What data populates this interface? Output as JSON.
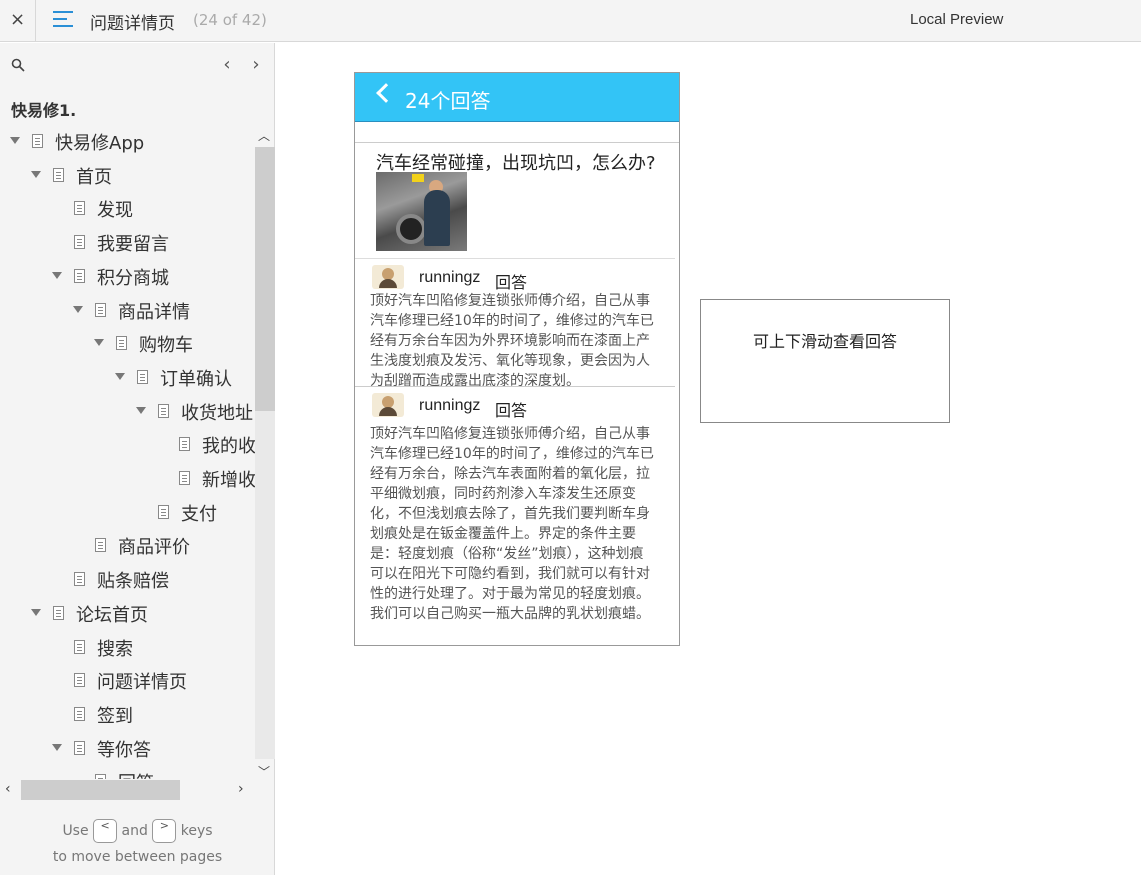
{
  "topbar": {
    "close_label": "×",
    "page_title": "问题详情页",
    "page_count": "(24 of 42)",
    "preview_label": "Local Preview"
  },
  "sidebar": {
    "project_title": "快易修1.",
    "tree": [
      {
        "label": "快易修App",
        "depth": 0,
        "expanded": true
      },
      {
        "label": "首页",
        "depth": 1,
        "expanded": true
      },
      {
        "label": "发现",
        "depth": 2
      },
      {
        "label": "我要留言",
        "depth": 2
      },
      {
        "label": "积分商城",
        "depth": 2,
        "expanded": true
      },
      {
        "label": "商品详情",
        "depth": 3,
        "expanded": true
      },
      {
        "label": "购物车",
        "depth": 4,
        "expanded": true
      },
      {
        "label": "订单确认",
        "depth": 5,
        "expanded": true
      },
      {
        "label": "收货地址",
        "depth": 6,
        "expanded": true
      },
      {
        "label": "我的收",
        "depth": 7
      },
      {
        "label": "新增收",
        "depth": 7
      },
      {
        "label": "支付",
        "depth": 6
      },
      {
        "label": "商品评价",
        "depth": 3
      },
      {
        "label": "贴条赔偿",
        "depth": 2
      },
      {
        "label": "论坛首页",
        "depth": 1,
        "expanded": true
      },
      {
        "label": "搜索",
        "depth": 2
      },
      {
        "label": "问题详情页",
        "depth": 2
      },
      {
        "label": "签到",
        "depth": 2
      },
      {
        "label": "等你答",
        "depth": 2,
        "expanded": true
      },
      {
        "label": "回答",
        "depth": 3
      }
    ],
    "vscroll_fraction": 0.43,
    "keys_hint": {
      "use": "Use",
      "key_prev": "<",
      "and": "and",
      "key_next": ">",
      "keys": "keys",
      "line2": "to move between pages"
    }
  },
  "phone": {
    "header_title": "24个回答",
    "question": "汽车经常碰撞，出现坑凹，怎么办?",
    "answers": [
      {
        "user": "runningz",
        "tag": "回答",
        "lines": [
          "顶好汽车凹陷修复连锁张师傅介绍，自己从事",
          "汽车修理已经10年的时间了，维修过的汽车已",
          "经有万余台车因为外界环境影响而在漆面上产",
          "生浅度划痕及发污、氧化等现象，更会因为人",
          "为刮蹭而造成露出底漆的深度划。"
        ]
      },
      {
        "user": "runningz",
        "tag": "回答",
        "lines": [
          "顶好汽车凹陷修复连锁张师傅介绍，自己从事",
          "汽车修理已经10年的时间了，维修过的汽车已",
          "经有万余台，除去汽车表面附着的氧化层，拉",
          "平细微划痕，同时药剂渗入车漆发生还原变",
          "化，不但浅划痕去除了，首先我们要判断车身",
          "划痕处是在钣金覆盖件上。界定的条件主要",
          "是：轻度划痕（俗称“发丝”划痕），这种划痕",
          "可以在阳光下可隐约看到，我们就可以有针对",
          "性的进行处理了。对于最为常见的轻度划痕。",
          "我们可以自己购买一瓶大品牌的乳状划痕蜡。"
        ]
      }
    ]
  },
  "note": {
    "text": "可上下滑动查看回答"
  },
  "colors": {
    "header_blue": "#33c4f6",
    "menu_icon_blue": "#2a8fd6"
  },
  "icons": {
    "close": "close-icon",
    "menu": "hamburger-menu-icon",
    "search": "search-icon",
    "prev": "chevron-left-icon",
    "next": "chevron-right-icon",
    "back": "back-chevron-icon",
    "doc": "document-icon",
    "expand": "triangle-down-icon"
  }
}
